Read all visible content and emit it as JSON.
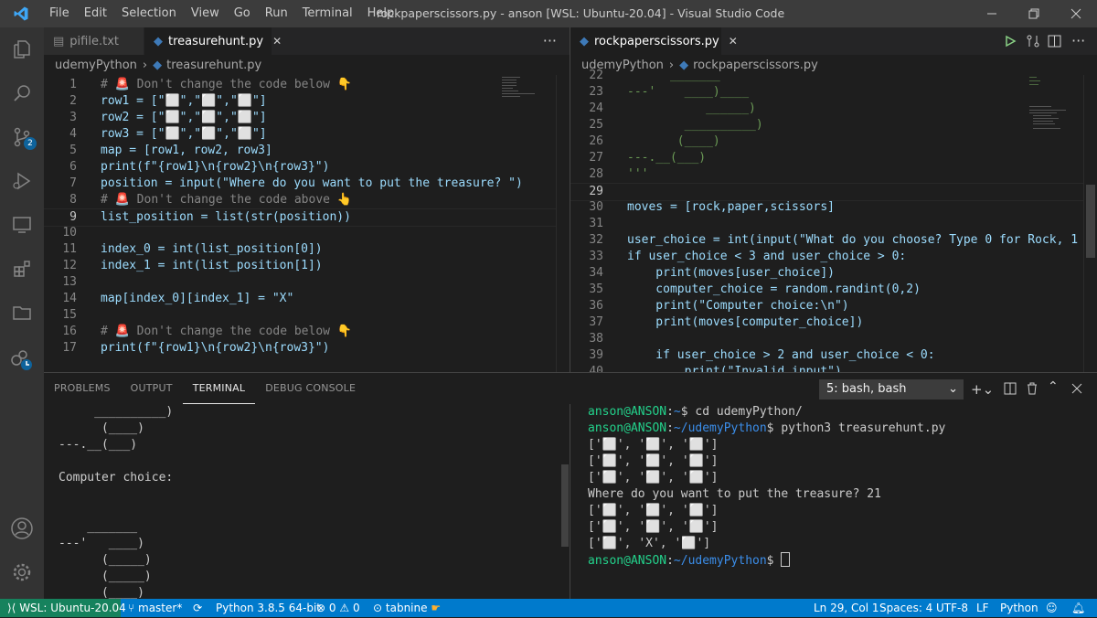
{
  "title_bar": {
    "menu": [
      "File",
      "Edit",
      "Selection",
      "View",
      "Go",
      "Run",
      "Terminal",
      "Help"
    ],
    "window_title": "rockpaperscissors.py - anson [WSL: Ubuntu-20.04] - Visual Studio Code"
  },
  "activity_bar": {
    "icons": [
      "files-icon",
      "search-icon",
      "source-control-icon",
      "run-debug-icon",
      "remote-explorer-icon",
      "extensions-icon",
      "folder-icon",
      "live-share-icon",
      "account-icon",
      "settings-gear-icon"
    ],
    "source_control_badge": "2"
  },
  "editor_left": {
    "tabs": [
      {
        "label": "pifile.txt"
      },
      {
        "label": "treasurehunt.py",
        "close": "✕"
      }
    ],
    "more": "···",
    "breadcrumb": [
      "udemyPython",
      "treasurehunt.py"
    ],
    "current_line": 9,
    "lines": [
      {
        "n": 1,
        "t": "# 🚨 Don't change the code below 👇"
      },
      {
        "n": 2,
        "t": "row1 = [\"⬜️\",\"⬜️\",\"⬜️\"]"
      },
      {
        "n": 3,
        "t": "row2 = [\"⬜️\",\"⬜️\",\"⬜️\"]"
      },
      {
        "n": 4,
        "t": "row3 = [\"⬜️\",\"⬜️\",\"⬜️\"]"
      },
      {
        "n": 5,
        "t": "map = [row1, row2, row3]"
      },
      {
        "n": 6,
        "t": "print(f\"{row1}\\n{row2}\\n{row3}\")"
      },
      {
        "n": 7,
        "t": "position = input(\"Where do you want to put the treasure? \")"
      },
      {
        "n": 8,
        "t": "# 🚨 Don't change the code above 👆"
      },
      {
        "n": 9,
        "t": "list_position = list(str(position))"
      },
      {
        "n": 10,
        "t": ""
      },
      {
        "n": 11,
        "t": "index_0 = int(list_position[0])"
      },
      {
        "n": 12,
        "t": "index_1 = int(list_position[1])"
      },
      {
        "n": 13,
        "t": ""
      },
      {
        "n": 14,
        "t": "map[index_0][index_1] = \"X\""
      },
      {
        "n": 15,
        "t": ""
      },
      {
        "n": 16,
        "t": "# 🚨 Don't change the code below 👇"
      },
      {
        "n": 17,
        "t": "print(f\"{row1}\\n{row2}\\n{row3}\")"
      }
    ]
  },
  "editor_right": {
    "tabs": [
      {
        "label": "rockpaperscissors.py",
        "close": "✕"
      }
    ],
    "breadcrumb": [
      "udemyPython",
      "rockpaperscissors.py"
    ],
    "current_line": 29,
    "lines": [
      {
        "n": 22,
        "t": "      _______"
      },
      {
        "n": 23,
        "t": "---'    ____)____"
      },
      {
        "n": 24,
        "t": "           ______)"
      },
      {
        "n": 25,
        "t": "        __________)"
      },
      {
        "n": 26,
        "t": "       (____)"
      },
      {
        "n": 27,
        "t": "---.__(___)"
      },
      {
        "n": 28,
        "t": "'''"
      },
      {
        "n": 29,
        "t": ""
      },
      {
        "n": 30,
        "t": "moves = [rock,paper,scissors]"
      },
      {
        "n": 31,
        "t": ""
      },
      {
        "n": 32,
        "t": "user_choice = int(input(\"What do you choose? Type 0 for Rock, 1"
      },
      {
        "n": 33,
        "t": "if user_choice < 3 and user_choice > 0:"
      },
      {
        "n": 34,
        "t": "    print(moves[user_choice])"
      },
      {
        "n": 35,
        "t": "    computer_choice = random.randint(0,2)"
      },
      {
        "n": 36,
        "t": "    print(\"Computer choice:\\n\")"
      },
      {
        "n": 37,
        "t": "    print(moves[computer_choice])"
      },
      {
        "n": 38,
        "t": ""
      },
      {
        "n": 39,
        "t": "    if user_choice > 2 and user_choice < 0:"
      },
      {
        "n": 40,
        "t": "        print(\"Invalid input\")"
      }
    ]
  },
  "panel": {
    "tabs": [
      "PROBLEMS",
      "OUTPUT",
      "TERMINAL",
      "DEBUG CONSOLE"
    ],
    "active_tab": "TERMINAL",
    "terminal_select": "5: bash, bash",
    "left_terminal": [
      "     __________)",
      "      (____)",
      "---.__(___)",
      "",
      "Computer choice:",
      "",
      "",
      "    _______",
      "---'   ____)",
      "      (_____)",
      "      (_____)",
      "      (____)",
      "---.__(___)"
    ],
    "right_terminal": {
      "prompt_user": "anson@ANSON",
      "line1_path": "~",
      "line1_cmd": "cd udemyPython/",
      "line2_path": "~/udemyPython",
      "line2_cmd": "python3 treasurehunt.py",
      "rows_before": [
        "['⬜️', '⬜️', '⬜️']",
        "['⬜️', '⬜️', '⬜️']",
        "['⬜️', '⬜️', '⬜️']"
      ],
      "question": "Where do you want to put the treasure? 21",
      "rows_after": [
        "['⬜️', '⬜️', '⬜️']",
        "['⬜️', '⬜️', '⬜️']",
        "['⬜️', 'X', '⬜️']"
      ],
      "line3_path": "~/udemyPython"
    }
  },
  "status_bar": {
    "remote": "WSL: Ubuntu-20.04",
    "branch": "master*",
    "python": "Python 3.8.5 64-bit",
    "errors": "0",
    "warnings": "0",
    "tabnine": "tabnine",
    "position": "Ln 29, Col 1",
    "spaces": "Spaces: 4",
    "encoding": "UTF-8",
    "eol": "LF",
    "language": "Python"
  },
  "colors": {
    "status_bar": "#007acc",
    "remote_indicator": "#16825d",
    "activity_bar": "#333333",
    "editor_bg": "#1e1e1e"
  }
}
